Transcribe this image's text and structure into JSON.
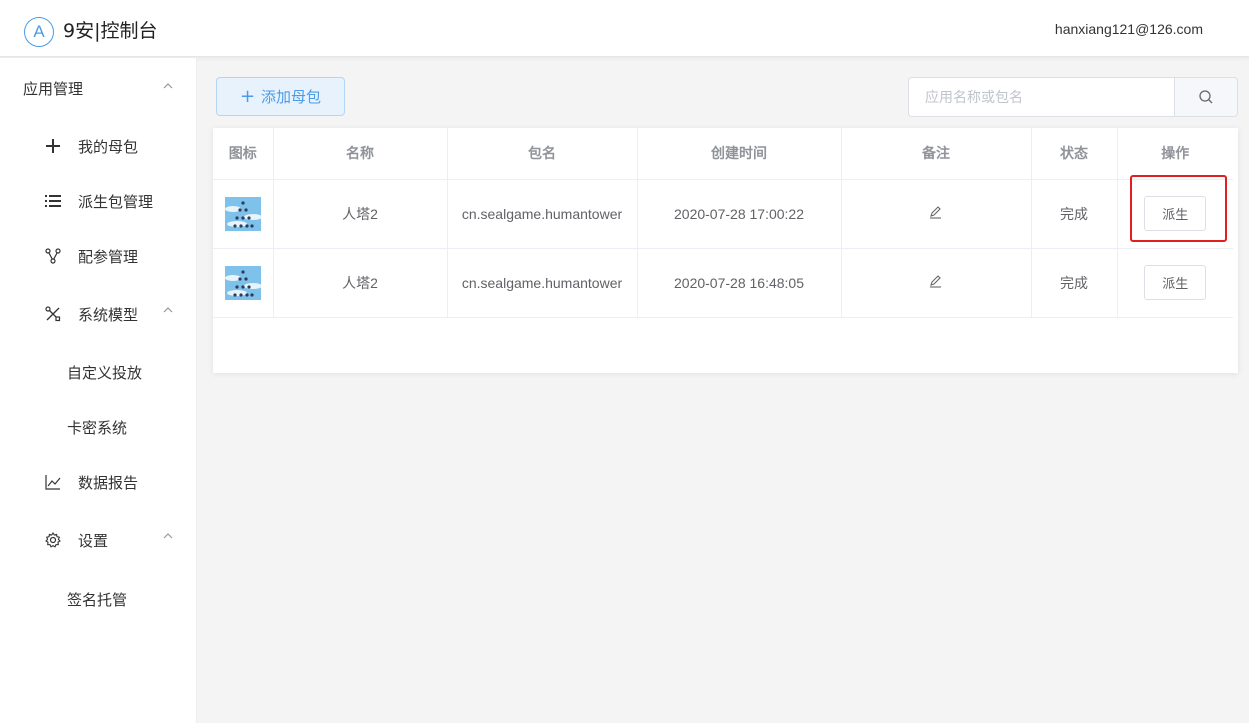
{
  "header": {
    "logo_letter": "A",
    "title": "9安|控制台",
    "user_email": "hanxiang121@126.com"
  },
  "sidebar": {
    "group_app": "应用管理",
    "items": [
      {
        "label": "我的母包",
        "icon": "plus-icon"
      },
      {
        "label": "派生包管理",
        "icon": "list-icon"
      },
      {
        "label": "配参管理",
        "icon": "branch-icon"
      },
      {
        "label": "系统模型",
        "icon": "tools-icon"
      }
    ],
    "sub_model": [
      "自定义投放",
      "卡密系统"
    ],
    "report": {
      "label": "数据报告",
      "icon": "chart-line-icon"
    },
    "settings": {
      "label": "设置",
      "icon": "gear-icon"
    },
    "sub_settings": [
      "签名托管"
    ]
  },
  "toolbar": {
    "add_label": "添加母包",
    "search_placeholder": "应用名称或包名"
  },
  "table": {
    "columns": [
      "图标",
      "名称",
      "包名",
      "创建时间",
      "备注",
      "状态",
      "操作"
    ],
    "rows": [
      {
        "name": "人塔2",
        "package": "cn.sealgame.humantower",
        "created": "2020-07-28 17:00:22",
        "status": "完成",
        "action": "派生"
      },
      {
        "name": "人塔2",
        "package": "cn.sealgame.humantower",
        "created": "2020-07-28 16:48:05",
        "status": "完成",
        "action": "派生"
      }
    ]
  },
  "colors": {
    "accent": "#4a9be8",
    "highlight": "#e02020"
  }
}
